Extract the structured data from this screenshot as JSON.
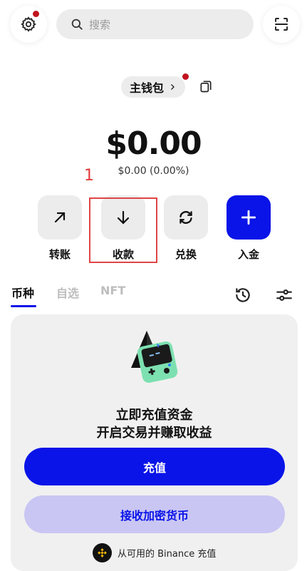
{
  "search": {
    "placeholder": "搜索"
  },
  "wallet": {
    "name": "主钱包"
  },
  "balance": {
    "amount": "$0.00",
    "change": "$0.00 (0.00%)"
  },
  "annotation": {
    "label": "1"
  },
  "actions": [
    {
      "label": "转账",
      "icon": "arrow-up-right-icon"
    },
    {
      "label": "收款",
      "icon": "arrow-down-icon"
    },
    {
      "label": "兑换",
      "icon": "swap-icon"
    },
    {
      "label": "入金",
      "icon": "plus-icon"
    }
  ],
  "tabs": [
    {
      "label": "币种",
      "active": true
    },
    {
      "label": "自选",
      "active": false
    },
    {
      "label": "NFT",
      "active": false
    }
  ],
  "card": {
    "title_line1": "立即充值资金",
    "title_line2": "开启交易并赚取收益",
    "deposit_button": "充值",
    "receive_crypto_button": "接收加密货币",
    "binance_text": "从可用的 Binance 充值"
  },
  "colors": {
    "accent": "#0a14e8",
    "notification_dot": "#c1121f",
    "annotation": "#e04545"
  }
}
